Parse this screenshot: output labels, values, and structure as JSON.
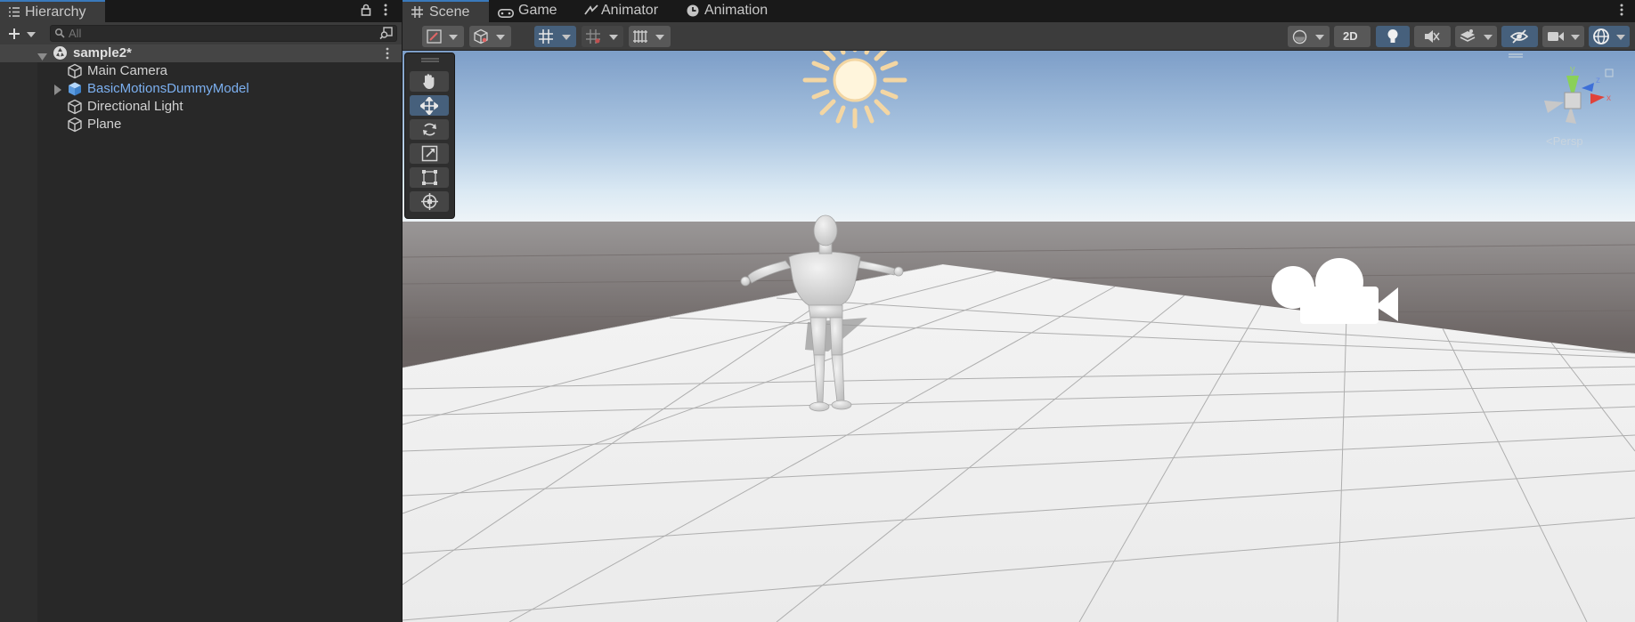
{
  "hierarchy": {
    "tab_label": "Hierarchy",
    "search_placeholder": "All",
    "scene_name": "sample2*",
    "items": [
      {
        "label": "Main Camera",
        "color": "#d2d2d2"
      },
      {
        "label": "BasicMotionsDummyModel",
        "color": "#7cb0f0"
      },
      {
        "label": "Directional Light",
        "color": "#d2d2d2"
      },
      {
        "label": "Plane",
        "color": "#d2d2d2"
      }
    ]
  },
  "scene_view": {
    "tabs": [
      {
        "label": "Scene",
        "icon": "grid-icon"
      },
      {
        "label": "Game",
        "icon": "gamepad-icon"
      },
      {
        "label": "Animator",
        "icon": "animator-icon"
      },
      {
        "label": "Animation",
        "icon": "clock-icon"
      }
    ],
    "toolbar": {
      "mode_2d_label": "2D"
    },
    "tools": [
      "hand-tool",
      "move-tool",
      "rotate-tool",
      "scale-tool",
      "rect-tool",
      "transform-tool"
    ],
    "gizmo": {
      "y_label": "y",
      "x_label": "x",
      "z_label": "z",
      "projection_label": "<Persp"
    }
  },
  "colors": {
    "accent": "#3a79bb",
    "selected_tool": "#46607c",
    "prefab_text": "#7cb0f0"
  }
}
